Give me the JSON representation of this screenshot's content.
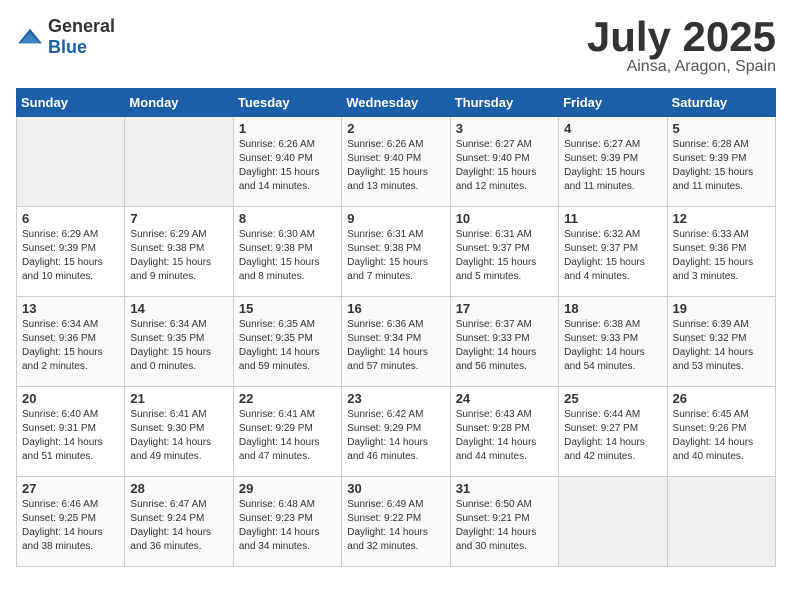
{
  "logo": {
    "general": "General",
    "blue": "Blue"
  },
  "title": "July 2025",
  "location": "Ainsa, Aragon, Spain",
  "days_of_week": [
    "Sunday",
    "Monday",
    "Tuesday",
    "Wednesday",
    "Thursday",
    "Friday",
    "Saturday"
  ],
  "weeks": [
    [
      {
        "day": "",
        "sunrise": "",
        "sunset": "",
        "daylight": ""
      },
      {
        "day": "",
        "sunrise": "",
        "sunset": "",
        "daylight": ""
      },
      {
        "day": "1",
        "sunrise": "Sunrise: 6:26 AM",
        "sunset": "Sunset: 9:40 PM",
        "daylight": "Daylight: 15 hours and 14 minutes."
      },
      {
        "day": "2",
        "sunrise": "Sunrise: 6:26 AM",
        "sunset": "Sunset: 9:40 PM",
        "daylight": "Daylight: 15 hours and 13 minutes."
      },
      {
        "day": "3",
        "sunrise": "Sunrise: 6:27 AM",
        "sunset": "Sunset: 9:40 PM",
        "daylight": "Daylight: 15 hours and 12 minutes."
      },
      {
        "day": "4",
        "sunrise": "Sunrise: 6:27 AM",
        "sunset": "Sunset: 9:39 PM",
        "daylight": "Daylight: 15 hours and 11 minutes."
      },
      {
        "day": "5",
        "sunrise": "Sunrise: 6:28 AM",
        "sunset": "Sunset: 9:39 PM",
        "daylight": "Daylight: 15 hours and 11 minutes."
      }
    ],
    [
      {
        "day": "6",
        "sunrise": "Sunrise: 6:29 AM",
        "sunset": "Sunset: 9:39 PM",
        "daylight": "Daylight: 15 hours and 10 minutes."
      },
      {
        "day": "7",
        "sunrise": "Sunrise: 6:29 AM",
        "sunset": "Sunset: 9:38 PM",
        "daylight": "Daylight: 15 hours and 9 minutes."
      },
      {
        "day": "8",
        "sunrise": "Sunrise: 6:30 AM",
        "sunset": "Sunset: 9:38 PM",
        "daylight": "Daylight: 15 hours and 8 minutes."
      },
      {
        "day": "9",
        "sunrise": "Sunrise: 6:31 AM",
        "sunset": "Sunset: 9:38 PM",
        "daylight": "Daylight: 15 hours and 7 minutes."
      },
      {
        "day": "10",
        "sunrise": "Sunrise: 6:31 AM",
        "sunset": "Sunset: 9:37 PM",
        "daylight": "Daylight: 15 hours and 5 minutes."
      },
      {
        "day": "11",
        "sunrise": "Sunrise: 6:32 AM",
        "sunset": "Sunset: 9:37 PM",
        "daylight": "Daylight: 15 hours and 4 minutes."
      },
      {
        "day": "12",
        "sunrise": "Sunrise: 6:33 AM",
        "sunset": "Sunset: 9:36 PM",
        "daylight": "Daylight: 15 hours and 3 minutes."
      }
    ],
    [
      {
        "day": "13",
        "sunrise": "Sunrise: 6:34 AM",
        "sunset": "Sunset: 9:36 PM",
        "daylight": "Daylight: 15 hours and 2 minutes."
      },
      {
        "day": "14",
        "sunrise": "Sunrise: 6:34 AM",
        "sunset": "Sunset: 9:35 PM",
        "daylight": "Daylight: 15 hours and 0 minutes."
      },
      {
        "day": "15",
        "sunrise": "Sunrise: 6:35 AM",
        "sunset": "Sunset: 9:35 PM",
        "daylight": "Daylight: 14 hours and 59 minutes."
      },
      {
        "day": "16",
        "sunrise": "Sunrise: 6:36 AM",
        "sunset": "Sunset: 9:34 PM",
        "daylight": "Daylight: 14 hours and 57 minutes."
      },
      {
        "day": "17",
        "sunrise": "Sunrise: 6:37 AM",
        "sunset": "Sunset: 9:33 PM",
        "daylight": "Daylight: 14 hours and 56 minutes."
      },
      {
        "day": "18",
        "sunrise": "Sunrise: 6:38 AM",
        "sunset": "Sunset: 9:33 PM",
        "daylight": "Daylight: 14 hours and 54 minutes."
      },
      {
        "day": "19",
        "sunrise": "Sunrise: 6:39 AM",
        "sunset": "Sunset: 9:32 PM",
        "daylight": "Daylight: 14 hours and 53 minutes."
      }
    ],
    [
      {
        "day": "20",
        "sunrise": "Sunrise: 6:40 AM",
        "sunset": "Sunset: 9:31 PM",
        "daylight": "Daylight: 14 hours and 51 minutes."
      },
      {
        "day": "21",
        "sunrise": "Sunrise: 6:41 AM",
        "sunset": "Sunset: 9:30 PM",
        "daylight": "Daylight: 14 hours and 49 minutes."
      },
      {
        "day": "22",
        "sunrise": "Sunrise: 6:41 AM",
        "sunset": "Sunset: 9:29 PM",
        "daylight": "Daylight: 14 hours and 47 minutes."
      },
      {
        "day": "23",
        "sunrise": "Sunrise: 6:42 AM",
        "sunset": "Sunset: 9:29 PM",
        "daylight": "Daylight: 14 hours and 46 minutes."
      },
      {
        "day": "24",
        "sunrise": "Sunrise: 6:43 AM",
        "sunset": "Sunset: 9:28 PM",
        "daylight": "Daylight: 14 hours and 44 minutes."
      },
      {
        "day": "25",
        "sunrise": "Sunrise: 6:44 AM",
        "sunset": "Sunset: 9:27 PM",
        "daylight": "Daylight: 14 hours and 42 minutes."
      },
      {
        "day": "26",
        "sunrise": "Sunrise: 6:45 AM",
        "sunset": "Sunset: 9:26 PM",
        "daylight": "Daylight: 14 hours and 40 minutes."
      }
    ],
    [
      {
        "day": "27",
        "sunrise": "Sunrise: 6:46 AM",
        "sunset": "Sunset: 9:25 PM",
        "daylight": "Daylight: 14 hours and 38 minutes."
      },
      {
        "day": "28",
        "sunrise": "Sunrise: 6:47 AM",
        "sunset": "Sunset: 9:24 PM",
        "daylight": "Daylight: 14 hours and 36 minutes."
      },
      {
        "day": "29",
        "sunrise": "Sunrise: 6:48 AM",
        "sunset": "Sunset: 9:23 PM",
        "daylight": "Daylight: 14 hours and 34 minutes."
      },
      {
        "day": "30",
        "sunrise": "Sunrise: 6:49 AM",
        "sunset": "Sunset: 9:22 PM",
        "daylight": "Daylight: 14 hours and 32 minutes."
      },
      {
        "day": "31",
        "sunrise": "Sunrise: 6:50 AM",
        "sunset": "Sunset: 9:21 PM",
        "daylight": "Daylight: 14 hours and 30 minutes."
      },
      {
        "day": "",
        "sunrise": "",
        "sunset": "",
        "daylight": ""
      },
      {
        "day": "",
        "sunrise": "",
        "sunset": "",
        "daylight": ""
      }
    ]
  ]
}
